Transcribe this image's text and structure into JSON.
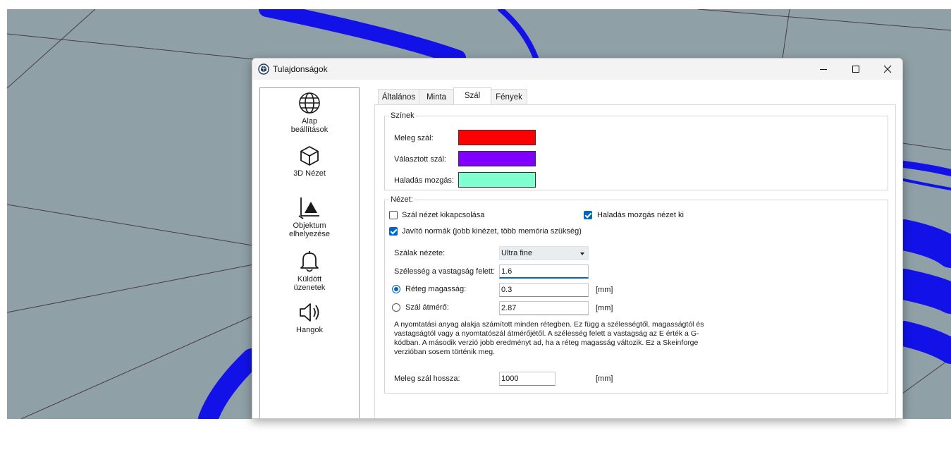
{
  "window": {
    "title": "Tulajdonságok",
    "minimize_icon": "minimize-icon",
    "maximize_icon": "maximize-icon",
    "close_icon": "close-icon"
  },
  "sidebar": {
    "items": [
      {
        "label": "Alap\nbeállítások",
        "icon": "globe-icon"
      },
      {
        "label": "3D Nézet",
        "icon": "cube-icon"
      },
      {
        "label": "Objektum\nelhelyezése",
        "icon": "object-placement-icon"
      },
      {
        "label": "Küldött\nüzenetek",
        "icon": "bell-icon"
      },
      {
        "label": "Hangok",
        "icon": "speaker-icon"
      }
    ]
  },
  "tabs": [
    {
      "label": "Általános",
      "active": false
    },
    {
      "label": "Minta",
      "active": false
    },
    {
      "label": "Szál",
      "active": true
    },
    {
      "label": "Fények",
      "active": false
    }
  ],
  "colors_group": {
    "legend": "Színek",
    "rows": [
      {
        "label": "Meleg szál:",
        "color": "#ff0000"
      },
      {
        "label": "Választott szál:",
        "color": "#8000ff"
      },
      {
        "label": "Haladás mozgás:",
        "color": "#80ffd0"
      }
    ]
  },
  "view_group": {
    "legend": "Nézet:",
    "disable_filament_view": {
      "label": "Szál nézet kikapcsolása",
      "checked": false
    },
    "travel_view_off": {
      "label": "Haladás mozgás nézet ki",
      "checked": true
    },
    "correct_normals": {
      "label": "Javító normák (jobb kinézet, több memória szükség)",
      "checked": true
    },
    "filament_view_label": "Szálak nézete:",
    "filament_view_value": "Ultra fine",
    "width_over_thickness_label": "Szélesség a vastagság felett:",
    "width_over_thickness_value": "1.6",
    "layer_height": {
      "label": "Réteg magasság:",
      "value": "0.3",
      "unit": "[mm]",
      "selected": true
    },
    "filament_diameter": {
      "label": "Szál átmérő:",
      "value": "2.87",
      "unit": "[mm]",
      "selected": false
    },
    "description": "A nyomtatási anyag alakja számított minden rétegben. Ez függ a szélességtől, magasságtól és vastagságtól vagy a nyomtatószál átmérőjétől. A szélesség felett a vastagság az E érték a G-kódban. A második verzió jobb eredményt ad, ha a réteg magasság változik. Ez a Skeinforge verzióban sosem történik meg.",
    "hot_filament_length": {
      "label": "Meleg szál hossza:",
      "value": "1000",
      "unit": "[mm]"
    }
  }
}
